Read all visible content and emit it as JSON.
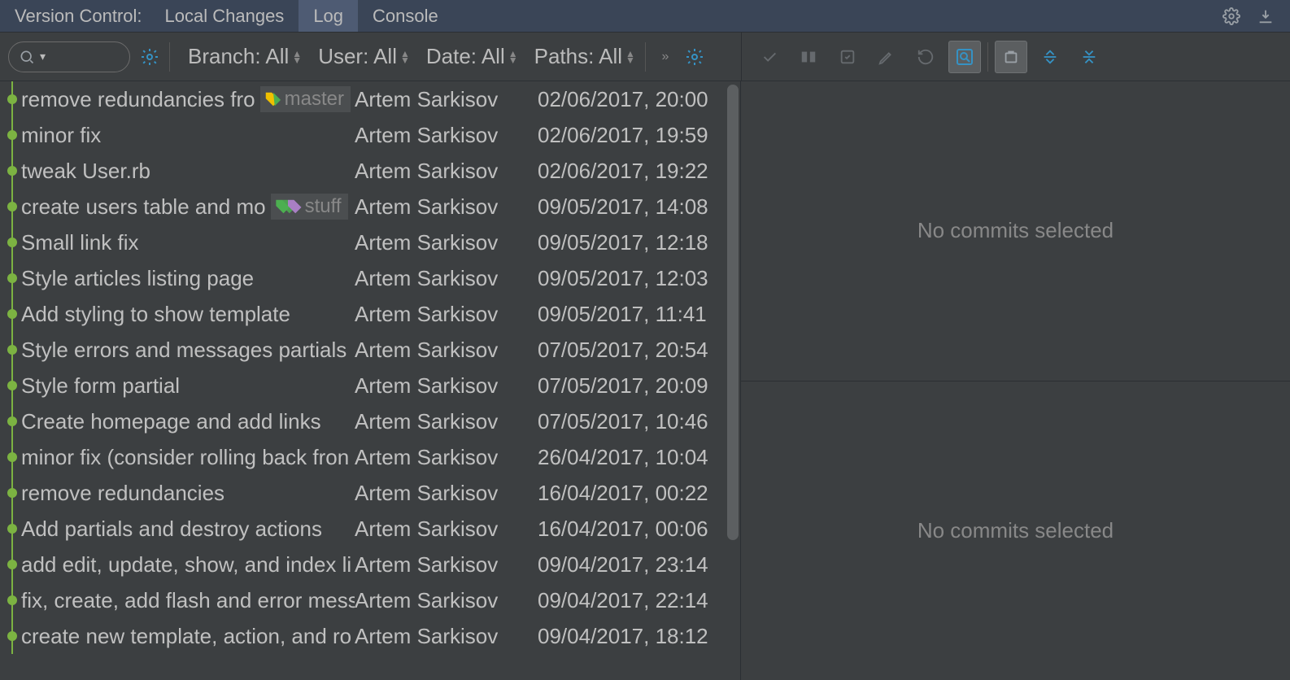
{
  "header": {
    "title": "Version Control:",
    "tabs": [
      {
        "label": "Local Changes",
        "active": false
      },
      {
        "label": "Log",
        "active": true
      },
      {
        "label": "Console",
        "active": false
      }
    ]
  },
  "filters": {
    "branch": "Branch: All",
    "user": "User: All",
    "date": "Date: All",
    "paths": "Paths: All"
  },
  "commits": [
    {
      "message": "remove redundancies fro",
      "author": "Artem Sarkisov",
      "date": "02/06/2017, 20:00",
      "tag": "master",
      "tagStyle": "single"
    },
    {
      "message": "minor fix",
      "author": "Artem Sarkisov",
      "date": "02/06/2017, 19:59"
    },
    {
      "message": "tweak User.rb",
      "author": "Artem Sarkisov",
      "date": "02/06/2017, 19:22"
    },
    {
      "message": "create users table and mo",
      "author": "Artem Sarkisov",
      "date": "09/05/2017, 14:08",
      "tag": "stuff",
      "tagStyle": "double"
    },
    {
      "message": "Small link fix",
      "author": "Artem Sarkisov",
      "date": "09/05/2017, 12:18"
    },
    {
      "message": "Style articles listing page",
      "author": "Artem Sarkisov",
      "date": "09/05/2017, 12:03"
    },
    {
      "message": "Add styling to show template",
      "author": "Artem Sarkisov",
      "date": "09/05/2017, 11:41"
    },
    {
      "message": "Style errors and messages partials",
      "author": "Artem Sarkisov",
      "date": "07/05/2017, 20:54"
    },
    {
      "message": "Style form partial",
      "author": "Artem Sarkisov",
      "date": "07/05/2017, 20:09"
    },
    {
      "message": "Create homepage and add links",
      "author": "Artem Sarkisov",
      "date": "07/05/2017, 10:46"
    },
    {
      "message": "minor fix (consider rolling back fron",
      "author": "Artem Sarkisov",
      "date": "26/04/2017, 10:04"
    },
    {
      "message": "remove redundancies",
      "author": "Artem Sarkisov",
      "date": "16/04/2017, 00:22"
    },
    {
      "message": "Add partials and destroy actions",
      "author": "Artem Sarkisov",
      "date": "16/04/2017, 00:06"
    },
    {
      "message": "add edit, update, show, and index li",
      "author": "Artem Sarkisov",
      "date": "09/04/2017, 23:14"
    },
    {
      "message": "fix, create, add flash and error mess",
      "author": "Artem Sarkisov",
      "date": "09/04/2017, 22:14"
    },
    {
      "message": "create new template, action, and ro",
      "author": "Artem Sarkisov",
      "date": "09/04/2017, 18:12"
    }
  ],
  "detail": {
    "placeholder": "No commits selected"
  }
}
